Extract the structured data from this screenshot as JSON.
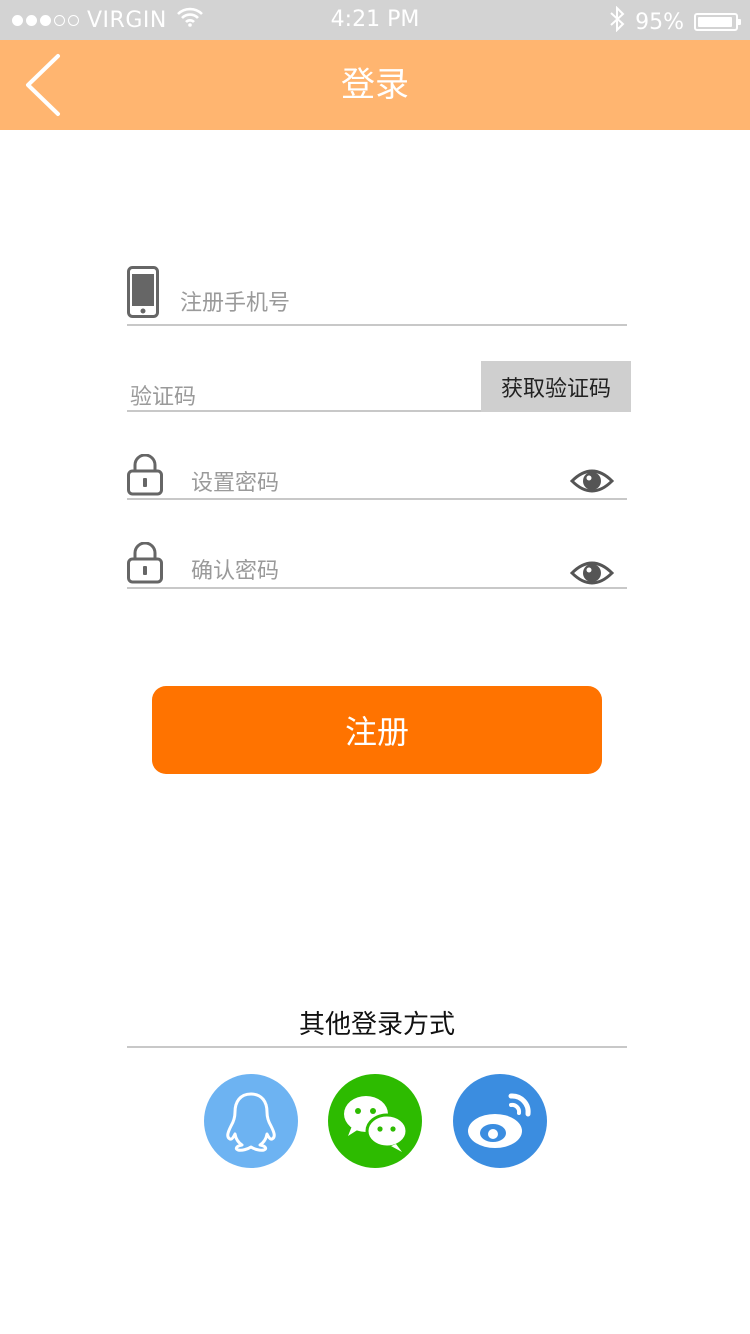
{
  "status_bar": {
    "carrier": "VIRGIN",
    "time": "4:21 PM",
    "battery": "95%",
    "battery_level": 0.95,
    "signal_bars": 3,
    "signal_total": 5
  },
  "nav": {
    "title": "登录",
    "back_icon": "chevron-left-icon",
    "background": "#ffb570"
  },
  "form": {
    "phone": {
      "placeholder": "注册手机号",
      "value": "",
      "icon": "phone-icon"
    },
    "code": {
      "placeholder": "验证码",
      "value": "",
      "button_label": "获取验证码"
    },
    "password": {
      "placeholder": "设置密码",
      "value": "",
      "icon": "lock-icon",
      "toggle_icon": "eye-icon"
    },
    "confirm": {
      "placeholder": "确认密码",
      "value": "",
      "icon": "lock-icon",
      "toggle_icon": "eye-icon"
    }
  },
  "register_button": {
    "label": "注册",
    "color": "#ff7300"
  },
  "other_login": {
    "title": "其他登录方式",
    "providers": [
      {
        "name": "qq-icon",
        "color": "#6db3f2"
      },
      {
        "name": "wechat-icon",
        "color": "#2dbb00"
      },
      {
        "name": "weibo-icon",
        "color": "#3b8de0"
      }
    ]
  }
}
